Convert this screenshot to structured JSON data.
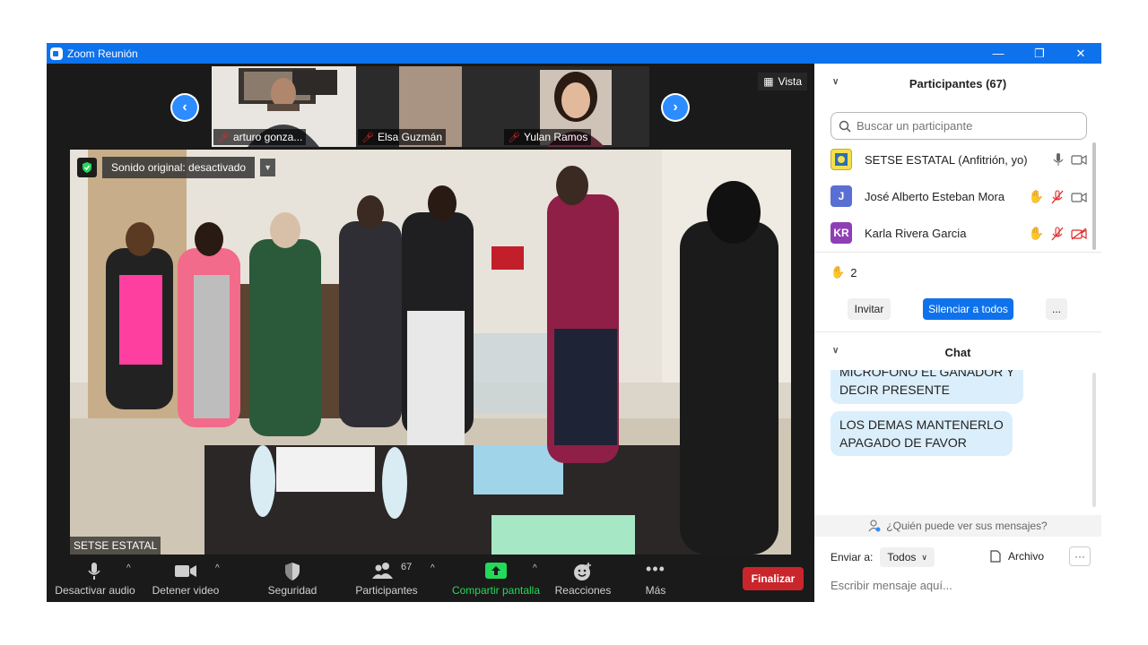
{
  "window": {
    "title": "Zoom Reunión",
    "controls": [
      "—",
      "❐",
      "✕"
    ]
  },
  "meeting": {
    "thumbnails": [
      {
        "name": "arturo gonza..."
      },
      {
        "name": "Elsa Guzmán"
      },
      {
        "name": "Yulan Ramos"
      }
    ],
    "view_label": "Vista",
    "original_sound": "Sonido original: desactivado",
    "main_video_name": "SETSE ESTATAL"
  },
  "toolbar": {
    "mute": "Desactivar audio",
    "video": "Detener video",
    "security": "Seguridad",
    "participants": "Participantes",
    "participants_count": "67",
    "share": "Compartir pantalla",
    "reactions": "Reacciones",
    "more": "Más",
    "end": "Finalizar"
  },
  "participants_panel": {
    "title": "Participantes (67)",
    "search_placeholder": "Buscar un participante",
    "list": [
      {
        "avatar": "",
        "name": "SETSE ESTATAL (Anfitrión, yo)",
        "color": "#f4e04d"
      },
      {
        "avatar": "J",
        "name": "José Alberto Esteban Mora",
        "color": "#5a6fd3"
      },
      {
        "avatar": "KR",
        "name": "Karla Rivera Garcia",
        "color": "#8e3fb5"
      }
    ],
    "raised_hands": "2",
    "invite": "Invitar",
    "mute_all": "Silenciar a todos",
    "more": "..."
  },
  "chat_panel": {
    "title": "Chat",
    "messages": [
      {
        "line1": "MICROFONO EL GANADOR Y",
        "line2": "DECIR PRESENTE"
      },
      {
        "line1": "LOS DEMAS MANTENERLO",
        "line2": "APAGADO DE FAVOR"
      }
    ],
    "who_can_see": "¿Quién puede ver sus mensajes?",
    "send_to_label": "Enviar a:",
    "send_to_value": "Todos",
    "file": "Archivo",
    "more": "···",
    "input_placeholder": "Escribir mensaje aquí..."
  },
  "colors": {
    "brand": "#0e72ed",
    "end": "#c9252b",
    "share": "#23d959",
    "bubble": "#dbeefb"
  }
}
